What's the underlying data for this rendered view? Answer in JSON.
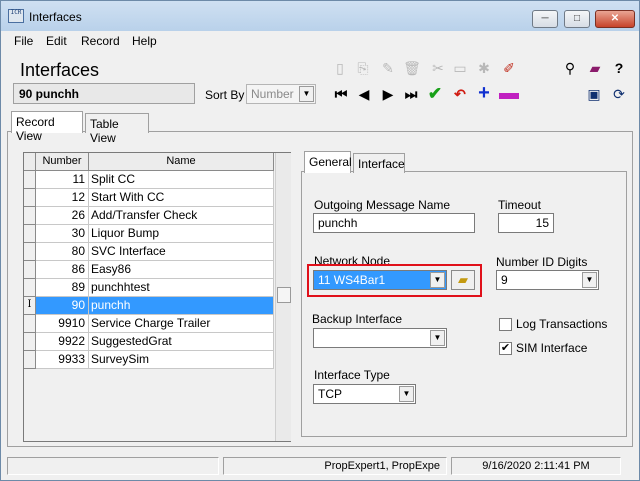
{
  "window": {
    "title": "Interfaces",
    "app_icon_text": "ICR"
  },
  "window_controls": {
    "minimize": "─",
    "maximize": "□",
    "close": "✕"
  },
  "menu": [
    "File",
    "Edit",
    "Record",
    "Help"
  ],
  "header": {
    "title": "Interfaces",
    "current_record": "90 punchh"
  },
  "sort_by": {
    "label": "Sort By",
    "value": "Number"
  },
  "toolbar_icons": {
    "dim": [
      "new-record-icon",
      "copy-record-icon",
      "edit-record-icon",
      "delete-icon",
      "cut-icon",
      "paste-icon",
      "paste-special-icon",
      "clear-icon"
    ],
    "right": [
      "binoculars-icon",
      "book-icon",
      "help-cursor-icon"
    ],
    "nav": [
      "first-record-icon",
      "previous-record-icon",
      "next-record-icon",
      "last-record-icon",
      "accept-icon",
      "undo-icon",
      "add-icon",
      "remove-icon"
    ],
    "extra": [
      "monitor-icon",
      "refresh-icon"
    ]
  },
  "view_tabs": [
    "Record View",
    "Table View"
  ],
  "grid": {
    "columns": [
      "Number",
      "Name"
    ],
    "rows": [
      {
        "number": "11",
        "name": "Split CC"
      },
      {
        "number": "12",
        "name": "Start With CC"
      },
      {
        "number": "26",
        "name": "Add/Transfer Check"
      },
      {
        "number": "30",
        "name": "Liquor Bump"
      },
      {
        "number": "80",
        "name": "SVC Interface"
      },
      {
        "number": "86",
        "name": "Easy86"
      },
      {
        "number": "89",
        "name": "punchhtest"
      },
      {
        "number": "90",
        "name": "punchh",
        "selected": true
      },
      {
        "number": "9910",
        "name": "Service Charge Trailer"
      },
      {
        "number": "9922",
        "name": "SuggestedGrat"
      },
      {
        "number": "9933",
        "name": "SurveySim"
      }
    ],
    "row_indicator": "I"
  },
  "detail_tabs": [
    "General",
    "Interface"
  ],
  "form": {
    "outgoing_message_name": {
      "label": "Outgoing Message Name",
      "value": "punchh"
    },
    "timeout": {
      "label": "Timeout",
      "value": "15"
    },
    "network_node": {
      "label": "Network Node",
      "value": "11  WS4Bar1"
    },
    "number_id_digits": {
      "label": "Number ID Digits",
      "value": "9"
    },
    "backup_interface": {
      "label": "Backup Interface",
      "value": ""
    },
    "log_transactions": {
      "label": "Log Transactions",
      "checked": false
    },
    "sim_interface": {
      "label": "SIM Interface",
      "checked": true
    },
    "interface_type": {
      "label": "Interface Type",
      "value": "TCP"
    }
  },
  "status_bar": {
    "user": "PropExpert1, PropExpe",
    "datetime": "9/16/2020 2:11:41 PM"
  }
}
